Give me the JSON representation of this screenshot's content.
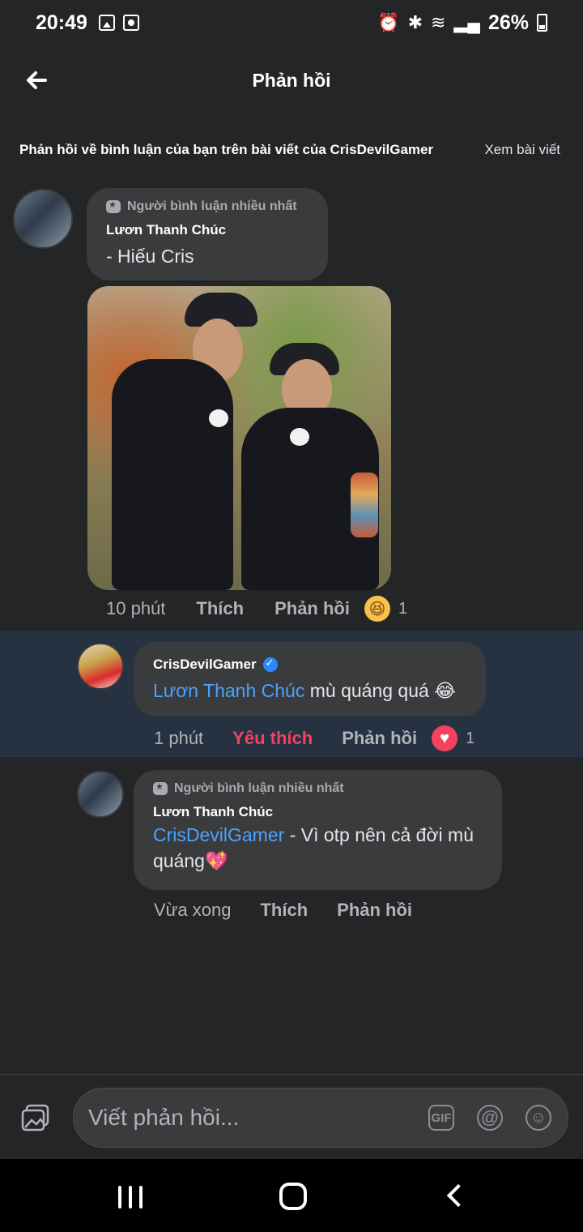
{
  "status_bar": {
    "time": "20:49",
    "battery": "26%"
  },
  "header": {
    "title": "Phản hồi"
  },
  "context": {
    "text": "Phản hồi về bình luận của bạn trên bài viết của CrisDevilGamer",
    "link": "Xem bài viết"
  },
  "comments": [
    {
      "badge": "Người bình luận nhiều nhất",
      "author": "Lươn Thanh Chúc",
      "text": "- Hiếu Cris",
      "time": "10 phút",
      "like": "Thích",
      "reply": "Phản hồi",
      "reaction_count": "1"
    },
    {
      "author": "CrisDevilGamer",
      "mention": "Lươn Thanh Chúc",
      "text": " mù quáng quá 😂",
      "time": "1 phút",
      "like": "Yêu thích",
      "reply": "Phản hồi",
      "reaction_count": "1"
    },
    {
      "badge": "Người bình luận nhiều nhất",
      "author": "Lươn Thanh Chúc",
      "mention": "CrisDevilGamer",
      "text": " - Vì otp nên cả đời mù quáng💖",
      "time": "Vừa xong",
      "like": "Thích",
      "reply": "Phản hồi"
    }
  ],
  "composer": {
    "placeholder": "Viết phản hồi...",
    "gif_label": "GIF"
  },
  "colors": {
    "background": "#242526",
    "bubble": "#3a3b3c",
    "mention": "#4aa3ff",
    "liked": "#f3425f",
    "highlight": "#263141"
  },
  "icons": [
    "back-arrow-icon",
    "badge-icon",
    "verified-icon",
    "haha-reaction-icon",
    "love-reaction-icon",
    "photo-icon",
    "gif-icon",
    "at-icon",
    "emoji-icon"
  ]
}
